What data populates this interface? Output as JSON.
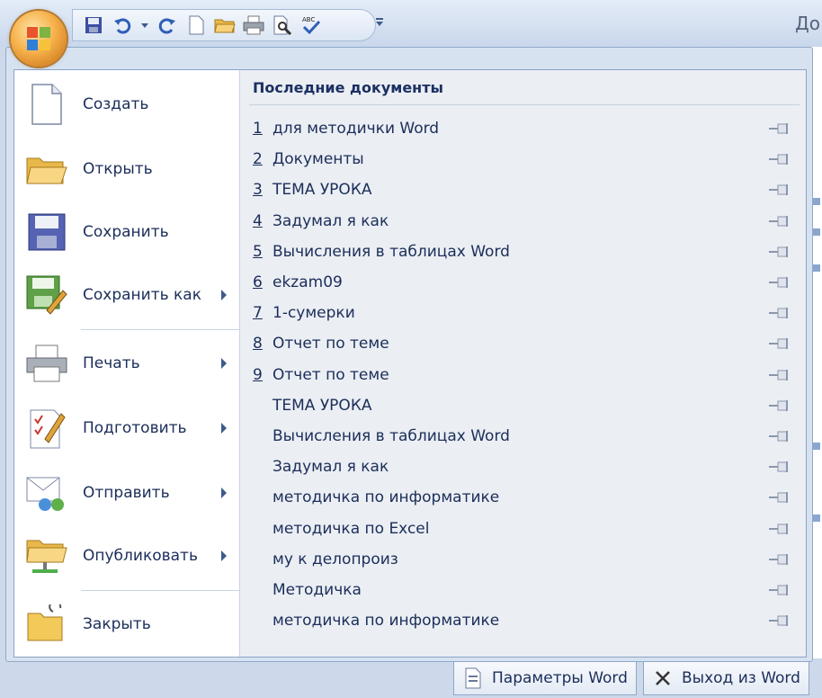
{
  "window": {
    "title_fragment": "До"
  },
  "quick_access": {
    "icons": [
      "save-icon",
      "undo-icon",
      "undo-dropdown-icon",
      "redo-icon",
      "new-doc-icon",
      "open-folder-icon",
      "print-icon",
      "print-preview-icon",
      "spelling-icon"
    ]
  },
  "menu": {
    "commands": [
      {
        "id": "create",
        "label": "Создать",
        "has_submenu": false,
        "icon": "new-document-icon"
      },
      {
        "id": "open",
        "label": "Открыть",
        "has_submenu": false,
        "icon": "open-folder-icon"
      },
      {
        "id": "save",
        "label": "Сохранить",
        "has_submenu": false,
        "icon": "save-icon"
      },
      {
        "id": "save-as",
        "label": "Сохранить как",
        "has_submenu": true,
        "icon": "save-as-icon"
      },
      {
        "id": "print",
        "label": "Печать",
        "has_submenu": true,
        "icon": "print-icon"
      },
      {
        "id": "prepare",
        "label": "Подготовить",
        "has_submenu": true,
        "icon": "prepare-icon"
      },
      {
        "id": "send",
        "label": "Отправить",
        "has_submenu": true,
        "icon": "send-icon"
      },
      {
        "id": "publish",
        "label": "Опубликовать",
        "has_submenu": true,
        "icon": "publish-icon"
      },
      {
        "id": "close",
        "label": "Закрыть",
        "has_submenu": false,
        "icon": "close-folder-icon"
      }
    ]
  },
  "recent": {
    "title": "Последние документы",
    "items": [
      {
        "num": "1",
        "name": "для методички Word"
      },
      {
        "num": "2",
        "name": "Документы"
      },
      {
        "num": "3",
        "name": "ТЕМА УРОКА"
      },
      {
        "num": "4",
        "name": "Задумал я как"
      },
      {
        "num": "5",
        "name": "Вычисления в таблицах Word"
      },
      {
        "num": "6",
        "name": "ekzam09"
      },
      {
        "num": "7",
        "name": "1-сумерки"
      },
      {
        "num": "8",
        "name": "Отчет по теме"
      },
      {
        "num": "9",
        "name": "Отчет по теме"
      },
      {
        "num": "",
        "name": "ТЕМА УРОКА"
      },
      {
        "num": "",
        "name": "Вычисления в таблицах Word"
      },
      {
        "num": "",
        "name": "Задумал я как"
      },
      {
        "num": "",
        "name": "методичка по информатике"
      },
      {
        "num": "",
        "name": "методичка по Excel"
      },
      {
        "num": "",
        "name": "му к делопроиз"
      },
      {
        "num": "",
        "name": "Методичка"
      },
      {
        "num": "",
        "name": "методичка по информатике"
      }
    ]
  },
  "footer": {
    "options_label": "Параметры Word",
    "exit_label": "Выход из Word"
  }
}
